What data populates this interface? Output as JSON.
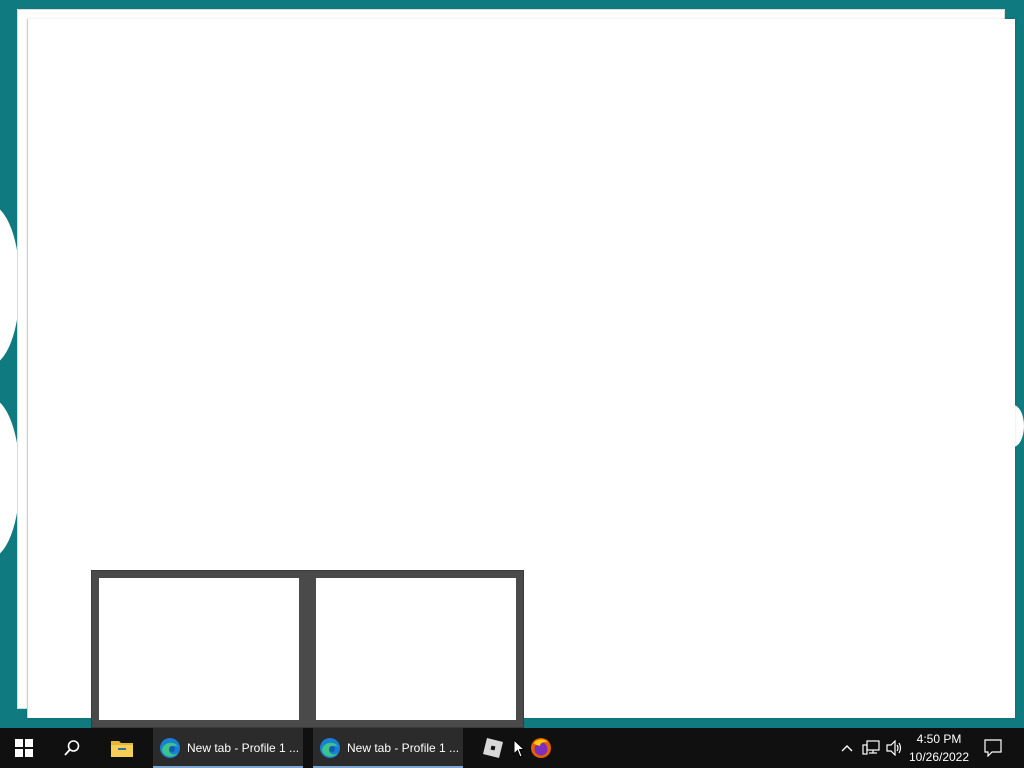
{
  "taskbar": {
    "start_icon": "windows-start-icon",
    "search_icon": "search-icon",
    "file_explorer_icon": "folder-icon",
    "apps": [
      {
        "label": "New tab - Profile 1 ...",
        "icon": "edge-icon"
      },
      {
        "label": "New tab - Profile 1 ...",
        "icon": "edge-icon"
      }
    ],
    "pinned": [
      {
        "icon": "roblox-icon"
      },
      {
        "icon": "firefox-icon"
      }
    ],
    "tray": {
      "chevron_icon": "chevron-up-icon",
      "network_icon": "network-icon",
      "volume_icon": "volume-icon",
      "notification_icon": "notification-icon"
    },
    "clock": {
      "time": "4:50 PM",
      "date": "10/26/2022"
    },
    "accent_color": "#7aa7d8"
  },
  "desktop": {
    "background_color": "#0f7a80"
  }
}
